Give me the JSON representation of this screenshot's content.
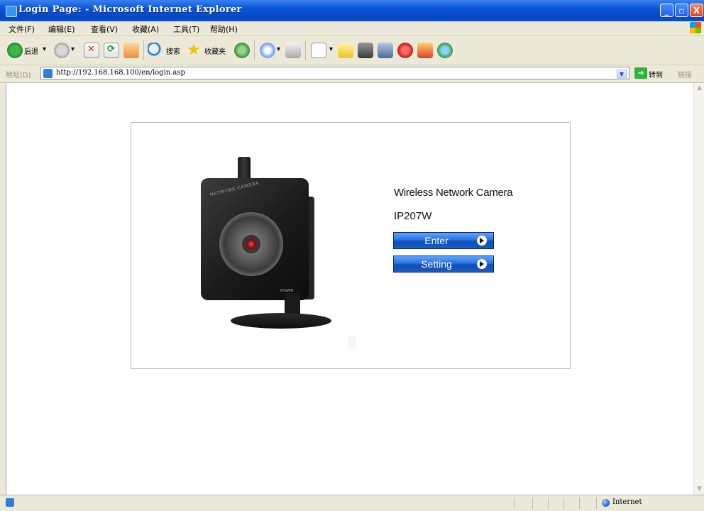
{
  "window": {
    "title": "Login Page: - Microsoft Internet Explorer",
    "min_glyph": "_",
    "max_glyph": "▫",
    "close_glyph": "X"
  },
  "menu": {
    "items": [
      "文件(F)",
      "编辑(E)",
      "查看(V)",
      "收藏(A)",
      "工具(T)",
      "帮助(H)"
    ]
  },
  "toolbar": {
    "back_label": "后退",
    "search_label": "搜索",
    "favorites_label": "收藏夹"
  },
  "address": {
    "label": "地址(D)",
    "url": "http://192.168.168.100/en/login.asp",
    "go_label": "转到",
    "links_label": "链接"
  },
  "page": {
    "product_title": "Wireless Network Camera",
    "product_model": "IP207W",
    "enter_label": "Enter",
    "setting_label": "Setting",
    "camera_brand": "NETWORK CAMERA",
    "camera_power": "POWER"
  },
  "status": {
    "zone": "Internet"
  },
  "colors": {
    "titlebar": "#0a54d8",
    "button_blue": "#2a73df",
    "chrome": "#ece9d8"
  },
  "icons": {
    "back": "back-arrow-icon",
    "forward": "forward-arrow-icon",
    "stop": "stop-icon",
    "refresh": "refresh-icon",
    "home": "home-icon",
    "search": "search-icon",
    "favorites": "star-icon",
    "history": "history-icon",
    "mail": "mail-icon",
    "print": "print-icon",
    "edit": "edit-icon"
  }
}
